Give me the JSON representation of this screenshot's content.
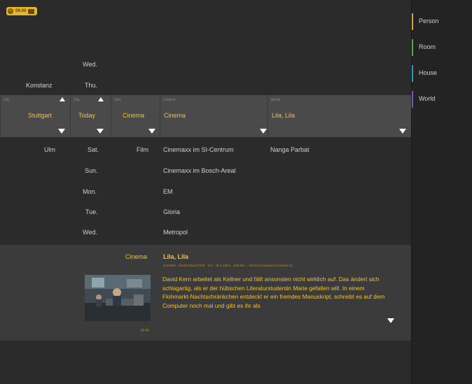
{
  "clock": {
    "time": "08:00"
  },
  "categories": [
    {
      "label": "Person",
      "color": "#e3a23a"
    },
    {
      "label": "Room",
      "color": "#4caf50"
    },
    {
      "label": "House",
      "color": "#2f9ac3"
    },
    {
      "label": "World",
      "color": "#6b5fc7"
    }
  ],
  "above": {
    "city": "Konstanz",
    "day_1": "Wed.",
    "day_2": "Thu."
  },
  "pickers": {
    "city": {
      "caption": "City",
      "value": "Stuttgart"
    },
    "day": {
      "caption": "Day",
      "value": "Today"
    },
    "type": {
      "caption": "Sort",
      "value": "Cinema"
    },
    "venue": {
      "caption": "Cinema",
      "value": "Cinema"
    },
    "title": {
      "caption": "Movie",
      "value": "Lila, Lila"
    }
  },
  "below": {
    "city": "Ulm",
    "days": [
      "Sat.",
      "Sun.",
      "Mon.",
      "Tue.",
      "Wed."
    ],
    "type": "Film",
    "venues": [
      "Cinemaxx im SI-Centrum",
      "Cinemaxx im Bosch-Areal",
      "EM",
      "Gloria",
      "Metropol"
    ],
    "title": "Nanga Parbat"
  },
  "detail": {
    "category": "Cinema",
    "title": "Lila, Lila",
    "meta": "Komödie · Deutschland 2009 · 110 · ab 6 Jahre · 108 Min. · Gloria Kinopalast (Kinosaal 11)",
    "description": "David Kern arbeitet als Kellner und fällt ansonsten nicht wirklich auf. Das ändert sich schlagartig, als er der hübschen Literaturstudentin Marie gefallen will. In einem Flohmarkt-Nachtschränkchen entdeckt er ein fremdes Manuskript, schreibt es auf dem Computer noch mal und gibt es ihr als",
    "time": "18:45"
  }
}
